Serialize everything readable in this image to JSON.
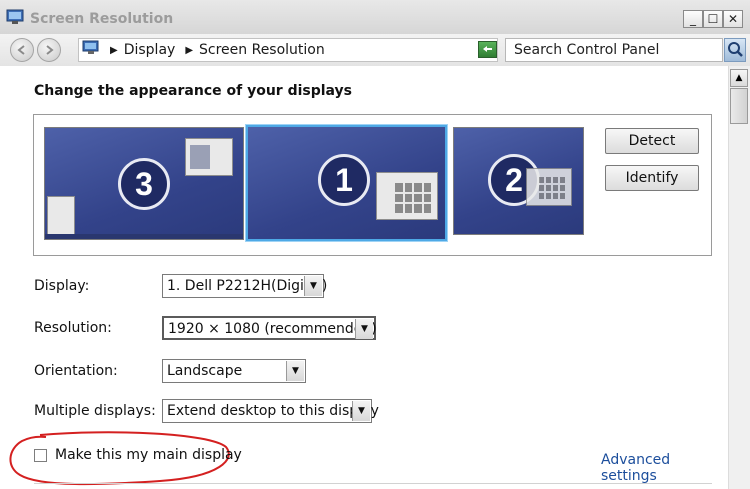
{
  "window": {
    "title": "Screen Resolution",
    "controls": {
      "minimize": "_",
      "maximize": "☐",
      "close": "✕"
    }
  },
  "address": {
    "crumbs": [
      "Display",
      "Screen Resolution"
    ],
    "search_placeholder": "Search Control Panel"
  },
  "main": {
    "heading": "Change the appearance of your displays",
    "monitors": [
      {
        "number": "3",
        "selected": false
      },
      {
        "number": "1",
        "selected": true
      },
      {
        "number": "2",
        "selected": false
      }
    ],
    "detect_label": "Detect",
    "identify_label": "Identify",
    "fields": {
      "display": {
        "label": "Display:",
        "value": "1. Dell P2212H(Digital)"
      },
      "resolution": {
        "label": "Resolution:",
        "value": "1920 × 1080 (recommended)"
      },
      "orientation": {
        "label": "Orientation:",
        "value": "Landscape"
      },
      "multiple": {
        "label": "Multiple displays:",
        "value": "Extend desktop to this display"
      }
    },
    "main_display_label": "Make this my main display",
    "main_display_checked": false,
    "advanced_link": "Advanced settings"
  },
  "colors": {
    "annotation_red": "#d42020",
    "accent_blue": "#4ea9e6",
    "link_blue": "#1c4e9c"
  }
}
